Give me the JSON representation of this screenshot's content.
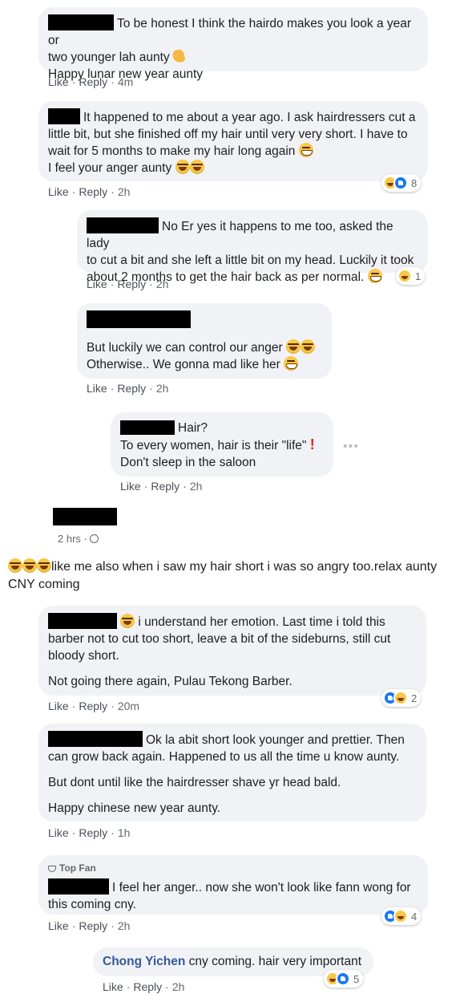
{
  "comments": [
    {
      "lines": [
        "To be honest I think the hairdo makes you look a year or",
        "two younger lah aunty",
        "Happy lunar new year aunty"
      ],
      "actions": {
        "like": "Like",
        "reply": "Reply",
        "time": "4m"
      }
    },
    {
      "lines": [
        "It happened to me about a year ago. I ask hairdressers cut a",
        "little bit, but she finished off my hair until very very short. I have to",
        "wait for 5 months to make my hair long again",
        "I feel your anger aunty"
      ],
      "actions": {
        "like": "Like",
        "reply": "Reply",
        "time": "2h"
      },
      "reactions": "8"
    },
    {
      "lines": [
        "No Er yes it happens to me too, asked the lady",
        "to cut a bit and she left a little bit on my head. Luckily it took",
        "about 2 months to get the hair back as per normal."
      ],
      "actions": {
        "like": "Like",
        "reply": "Reply",
        "time": "2h"
      },
      "reactions": "1"
    },
    {
      "lines": [
        "But luckily we can control our anger",
        "Otherwise.. We gonna mad like her"
      ],
      "actions": {
        "like": "Like",
        "reply": "Reply",
        "time": "2h"
      }
    },
    {
      "lines": [
        "Hair?",
        "To every women, hair is their \"life\"",
        "Don't sleep in the saloon"
      ],
      "actions": {
        "like": "Like",
        "reply": "Reply",
        "time": "2h"
      },
      "more": "•••"
    }
  ],
  "post": {
    "time": "2 hrs ·",
    "text_1": "like me also when i saw my hair short i was so angry too.relax aunty",
    "text_2": "CNY coming"
  },
  "replies": [
    {
      "lines": [
        "i understand her emotion. Last time i told this",
        "barber not to cut too short, leave a bit of the sideburns, still cut",
        "bloody short.",
        "Not going there again, Pulau Tekong Barber."
      ],
      "actions": {
        "like": "Like",
        "reply": "Reply",
        "time": "20m"
      },
      "reactions": "2"
    },
    {
      "lines": [
        "Ok la abit short look younger and prettier. Then",
        "can grow back again. Happened to us all the time u know aunty.",
        "But dont until like the hairdresser shave yr head bald.",
        "Happy chinese new year aunty."
      ],
      "actions": {
        "like": "Like",
        "reply": "Reply",
        "time": "1h"
      }
    },
    {
      "badge": "Top Fan",
      "lines": [
        "I feel her anger.. now she won't look like fann wong for",
        "this coming cny."
      ],
      "actions": {
        "like": "Like",
        "reply": "Reply",
        "time": "2h"
      },
      "reactions": "4"
    },
    {
      "name": "Chong Yichen",
      "text": "cny coming. hair very important",
      "actions": {
        "like": "Like",
        "reply": "Reply",
        "time": "2h"
      },
      "reactions": "5"
    }
  ]
}
